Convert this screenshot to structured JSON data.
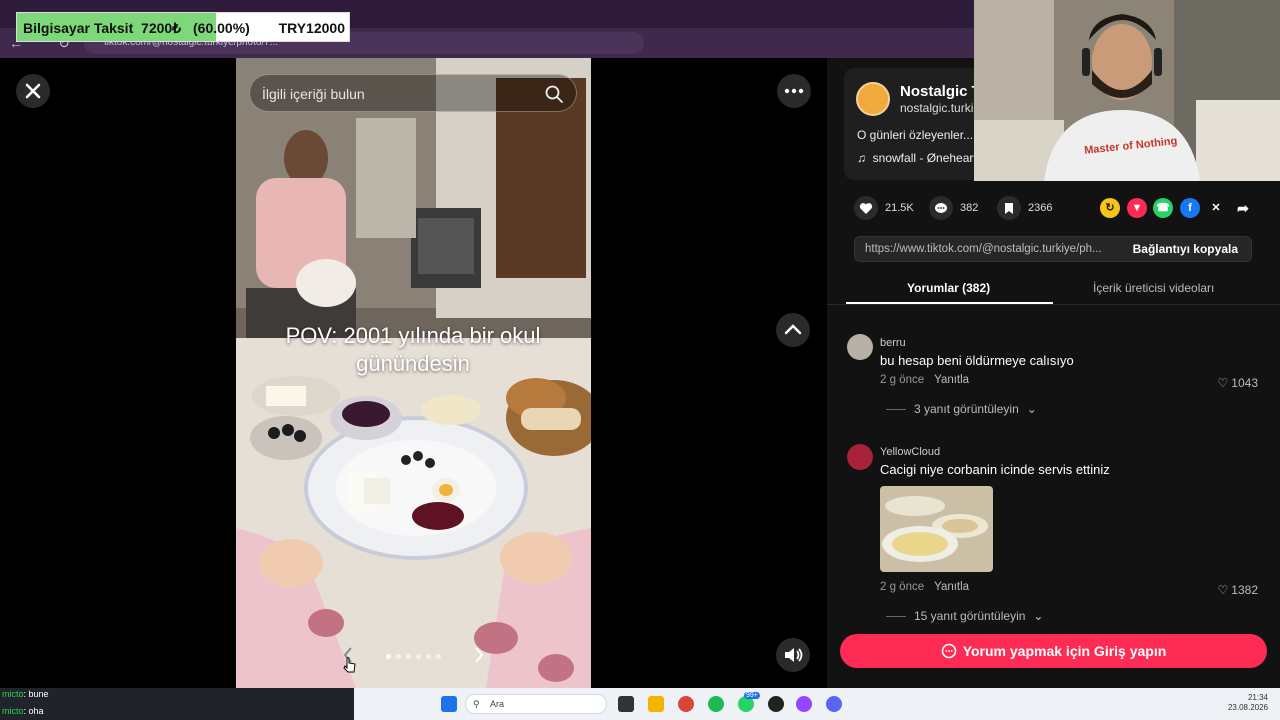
{
  "overlay": {
    "banner_label": "Bilgisayar Taksit",
    "banner_amount": "7200₺",
    "banner_percent_text": "(60.00%)",
    "banner_target": "TRY12000",
    "progress_fraction": 0.6
  },
  "browser": {
    "url": "tiktok.com/@nostalgic.turkiye/photo/7..."
  },
  "viewer": {
    "search_placeholder": "İlgili içeriği bulun",
    "caption": "POV: 2001 yılında bir okul günündesin",
    "slide_count": 6,
    "active_slide": 1
  },
  "post": {
    "author_name": "Nostalgic T",
    "author_handle": "nostalgic.turki",
    "description": "O günleri özleyenler...",
    "music": "snowfall - Øneheart",
    "likes": "21.5K",
    "comments": "382",
    "saves": "2366",
    "link": "https://www.tiktok.com/@nostalgic.turkiye/ph...",
    "copy_label": "Bağlantıyı kopyala"
  },
  "tabs": {
    "comments_label": "Yorumlar (382)",
    "creator_videos_label": "İçerik üreticisi videoları"
  },
  "comments": [
    {
      "user": "berru",
      "text": "bu hesap beni öldürmeye calısıyo",
      "time": "2 g önce",
      "reply_label": "Yanıtla",
      "likes": "1043",
      "view_replies": "3 yanıt görüntüleyin"
    },
    {
      "user": "YellowCloud",
      "text": "Cacigi niye corbanin icinde servis ettiniz",
      "time": "2 g önce",
      "reply_label": "Yanıtla",
      "likes": "1382",
      "view_replies": "15 yanıt görüntüleyin"
    }
  ],
  "login_button": "Yorum yapmak için Giriş yapın",
  "webcam": {
    "shirt_text": "Master of Nothing"
  },
  "chat": [
    {
      "user": "micto",
      "message": ": bune"
    },
    {
      "user": "micto",
      "message": ": oha"
    }
  ],
  "taskbar": {
    "search_label": "Ara",
    "whatsapp_badge": "99+",
    "time": "21:34",
    "date": "23.08.2026"
  },
  "colors": {
    "accent": "#fe2c55",
    "progress_fill": "#7dd87a"
  }
}
